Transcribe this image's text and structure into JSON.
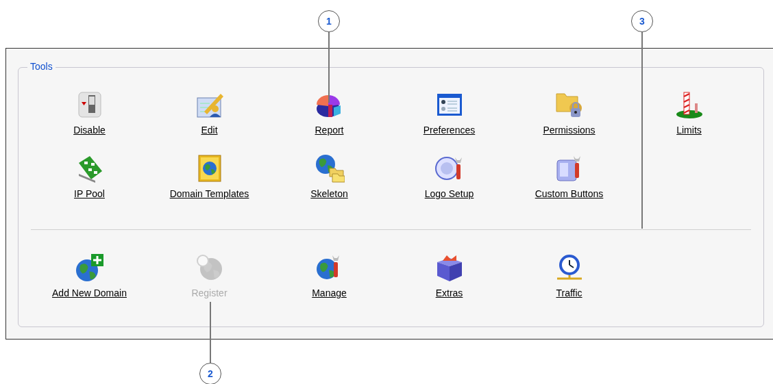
{
  "panel": {
    "legend": "Tools",
    "sections": [
      {
        "items": [
          {
            "label": "Disable",
            "kind": "switch",
            "disabled": false
          },
          {
            "label": "Edit",
            "kind": "pen",
            "disabled": false
          },
          {
            "label": "Report",
            "kind": "pie",
            "disabled": false
          },
          {
            "label": "Preferences",
            "kind": "window",
            "disabled": false
          },
          {
            "label": "Permissions",
            "kind": "lock",
            "disabled": false
          },
          {
            "label": "Limits",
            "kind": "pole",
            "disabled": false
          },
          {
            "label": "IP Pool",
            "kind": "board",
            "disabled": false
          },
          {
            "label": "Domain Templates",
            "kind": "atlas",
            "disabled": false
          },
          {
            "label": "Skeleton",
            "kind": "skeleton",
            "disabled": false
          },
          {
            "label": "Logo Setup",
            "kind": "trademark",
            "disabled": false
          },
          {
            "label": "Custom Buttons",
            "kind": "tool",
            "disabled": false
          }
        ]
      },
      {
        "items": [
          {
            "label": "Add New Domain",
            "kind": "add",
            "disabled": false
          },
          {
            "label": "Register",
            "kind": "register",
            "disabled": true
          },
          {
            "label": "Manage",
            "kind": "manage",
            "disabled": false
          },
          {
            "label": "Extras",
            "kind": "box",
            "disabled": false
          },
          {
            "label": "Traffic",
            "kind": "clock",
            "disabled": false
          }
        ]
      }
    ]
  },
  "callouts": [
    {
      "number": "1"
    },
    {
      "number": "3"
    },
    {
      "number": "2"
    }
  ]
}
